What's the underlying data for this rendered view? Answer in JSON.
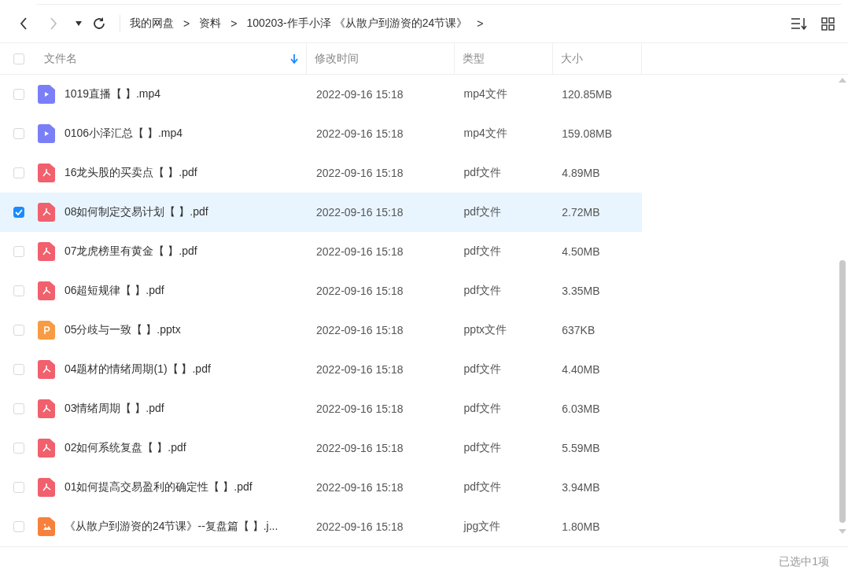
{
  "toolbar": {
    "breadcrumb": [
      "我的网盘",
      "资料",
      "100203-作手小泽 《从散户到游资的24节课》"
    ],
    "separator": ">"
  },
  "table": {
    "select_all": {
      "checked": false
    },
    "columns": [
      {
        "label": "文件名",
        "sorted": true
      },
      {
        "label": "修改时间",
        "sorted": false
      },
      {
        "label": "类型",
        "sorted": false
      },
      {
        "label": "大小",
        "sorted": false
      }
    ],
    "rows": [
      {
        "kind": "video",
        "name": "1019直播【 】.mp4",
        "time": "2022-09-16 15:18",
        "type": "mp4文件",
        "size": "120.85MB",
        "selected": false
      },
      {
        "kind": "video",
        "name": "0106小泽汇总【 】.mp4",
        "time": "2022-09-16 15:18",
        "type": "mp4文件",
        "size": "159.08MB",
        "selected": false
      },
      {
        "kind": "pdf",
        "name": "16龙头股的买卖点【 】.pdf",
        "time": "2022-09-16 15:18",
        "type": "pdf文件",
        "size": "4.89MB",
        "selected": false
      },
      {
        "kind": "pdf",
        "name": "08如何制定交易计划【 】.pdf",
        "time": "2022-09-16 15:18",
        "type": "pdf文件",
        "size": "2.72MB",
        "selected": true
      },
      {
        "kind": "pdf",
        "name": "07龙虎榜里有黄金【 】.pdf",
        "time": "2022-09-16 15:18",
        "type": "pdf文件",
        "size": "4.50MB",
        "selected": false
      },
      {
        "kind": "pdf",
        "name": "06超短规律【 】.pdf",
        "time": "2022-09-16 15:18",
        "type": "pdf文件",
        "size": "3.35MB",
        "selected": false
      },
      {
        "kind": "ppt",
        "name": "05分歧与一致【 】.pptx",
        "time": "2022-09-16 15:18",
        "type": "pptx文件",
        "size": "637KB",
        "selected": false
      },
      {
        "kind": "pdf",
        "name": "04题材的情绪周期(1)【 】.pdf",
        "time": "2022-09-16 15:18",
        "type": "pdf文件",
        "size": "4.40MB",
        "selected": false
      },
      {
        "kind": "pdf",
        "name": "03情绪周期【 】.pdf",
        "time": "2022-09-16 15:18",
        "type": "pdf文件",
        "size": "6.03MB",
        "selected": false
      },
      {
        "kind": "pdf",
        "name": "02如何系统复盘【 】.pdf",
        "time": "2022-09-16 15:18",
        "type": "pdf文件",
        "size": "5.59MB",
        "selected": false
      },
      {
        "kind": "pdf",
        "name": "01如何提高交易盈利的确定性【 】.pdf",
        "time": "2022-09-16 15:18",
        "type": "pdf文件",
        "size": "3.94MB",
        "selected": false
      },
      {
        "kind": "image",
        "name": "《从散户到游资的24节课》--复盘篇【 】.j...",
        "time": "2022-09-16 15:18",
        "type": "jpg文件",
        "size": "1.80MB",
        "selected": false
      }
    ]
  },
  "status_bar": {
    "text": "已选中1项"
  }
}
